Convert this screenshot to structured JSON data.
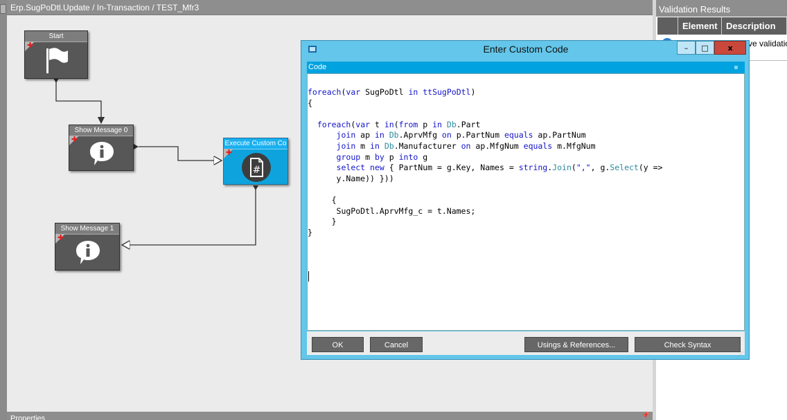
{
  "designer": {
    "breadcrumb": "Erp.SugPoDtl.Update / In-Transaction / TEST_Mfr3",
    "properties_label": "Properties"
  },
  "nodes": {
    "start": "Start",
    "show_message_0": "Show Message 0",
    "execute_custom_code": "Execute Custom Co",
    "show_message_1": "Show Message 1"
  },
  "validation": {
    "title": "Validation Results",
    "col_element": "Element",
    "col_description": "Description",
    "row_text": "ve validatio"
  },
  "dialog": {
    "title": "Enter Custom Code",
    "code_label": "Code",
    "minimize": "–",
    "maximize": "□",
    "close": "x",
    "buttons": {
      "ok": "OK",
      "cancel": "Cancel",
      "usings": "Usings & References...",
      "check_syntax": "Check Syntax"
    }
  },
  "colors": {
    "node_gray": "#575757",
    "node_blue": "#0ea3dd",
    "dialog_frame": "#63c6ea",
    "code_bar": "#00a2e0",
    "keyword": "#1414c8",
    "type": "#2b8a9e"
  }
}
